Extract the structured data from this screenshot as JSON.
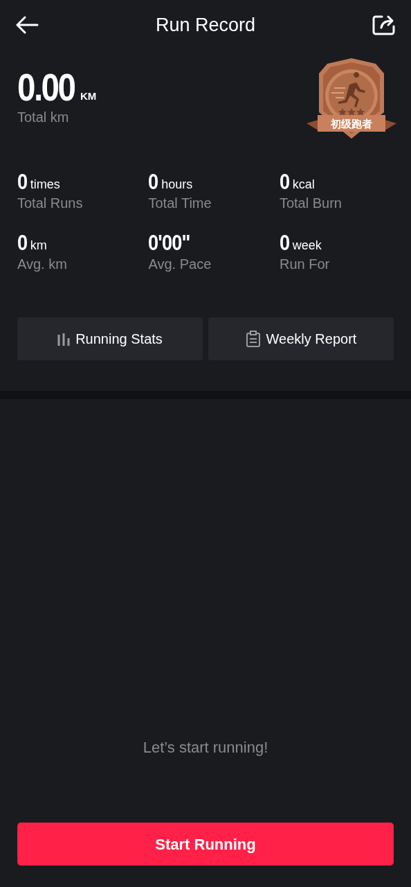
{
  "header": {
    "title": "Run Record"
  },
  "total": {
    "value": "0.00",
    "unit": "KM",
    "label": "Total km"
  },
  "badge": {
    "label": "初级跑者"
  },
  "stats": [
    {
      "value": "0",
      "unit": "times",
      "label": "Total Runs"
    },
    {
      "value": "0",
      "unit": "hours",
      "label": "Total Time"
    },
    {
      "value": "0",
      "unit": "kcal",
      "label": "Total Burn"
    },
    {
      "value": "0",
      "unit": "km",
      "label": "Avg. km"
    },
    {
      "value": "0'00\"",
      "label": "Avg. Pace"
    },
    {
      "value": "0",
      "unit": "week",
      "label": "Run For"
    }
  ],
  "actions": [
    {
      "kind": "stats",
      "label": "Running Stats"
    },
    {
      "kind": "report",
      "label": "Weekly Report"
    }
  ],
  "empty_message": "Let’s start running!",
  "start_button": "Start Running"
}
